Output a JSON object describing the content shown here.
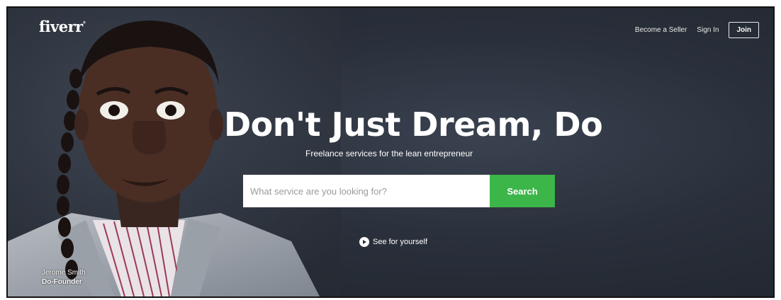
{
  "header": {
    "logo_text": "fiverr",
    "logo_mark": "°",
    "nav": {
      "become_seller": "Become a Seller",
      "sign_in": "Sign In",
      "join": "Join"
    }
  },
  "hero": {
    "headline": "Don't Just Dream, Do",
    "subheadline": "Freelance services for the lean entrepreneur",
    "search": {
      "placeholder": "What service are you looking for?",
      "button_label": "Search"
    },
    "see_link": "See for yourself",
    "caption": {
      "name": "Jerome Smith",
      "title": "Do-Founder"
    }
  },
  "colors": {
    "background": "#2a303b",
    "search_button": "#3cb549",
    "text": "#ffffff"
  },
  "icons": {
    "play": "play-circle-icon"
  }
}
